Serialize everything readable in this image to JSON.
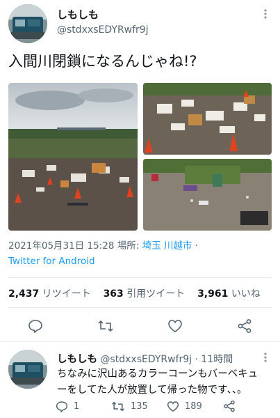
{
  "main_tweet": {
    "author_name": "しもしも",
    "author_handle": "@stdxxsEDYRwfr9j",
    "text": "入間川閉鎖になるんじゃね!?",
    "timestamp": "2021年05月31日 15:28",
    "place_label": "場所:",
    "place_link": "埼玉 川越市",
    "separator": "·",
    "source": "Twitter for Android",
    "stats": {
      "retweets": "2,437",
      "retweets_label": "リツイート",
      "quotes": "363",
      "quotes_label": "引用ツイート",
      "likes": "3,961",
      "likes_label": "いいね"
    }
  },
  "reply": {
    "author_name": "しもしも",
    "author_handle": "@stdxxsEDYRwfr9j",
    "separator": "·",
    "time": "11時間",
    "text_line1": "ちなみに沢山あるカラーコーンもバーベキュ",
    "text_line2": "ーをしてた人が放置して帰った物です、、。",
    "counts": {
      "reply": "1",
      "retweet": "135",
      "like": "189"
    }
  },
  "icons": [
    "more-icon",
    "reply-icon",
    "retweet-icon",
    "like-icon",
    "share-icon"
  ],
  "colors": {
    "link": "#1d9bf0",
    "text": "#0f1419",
    "secondary": "#536471",
    "divider": "#e6ecf0"
  }
}
